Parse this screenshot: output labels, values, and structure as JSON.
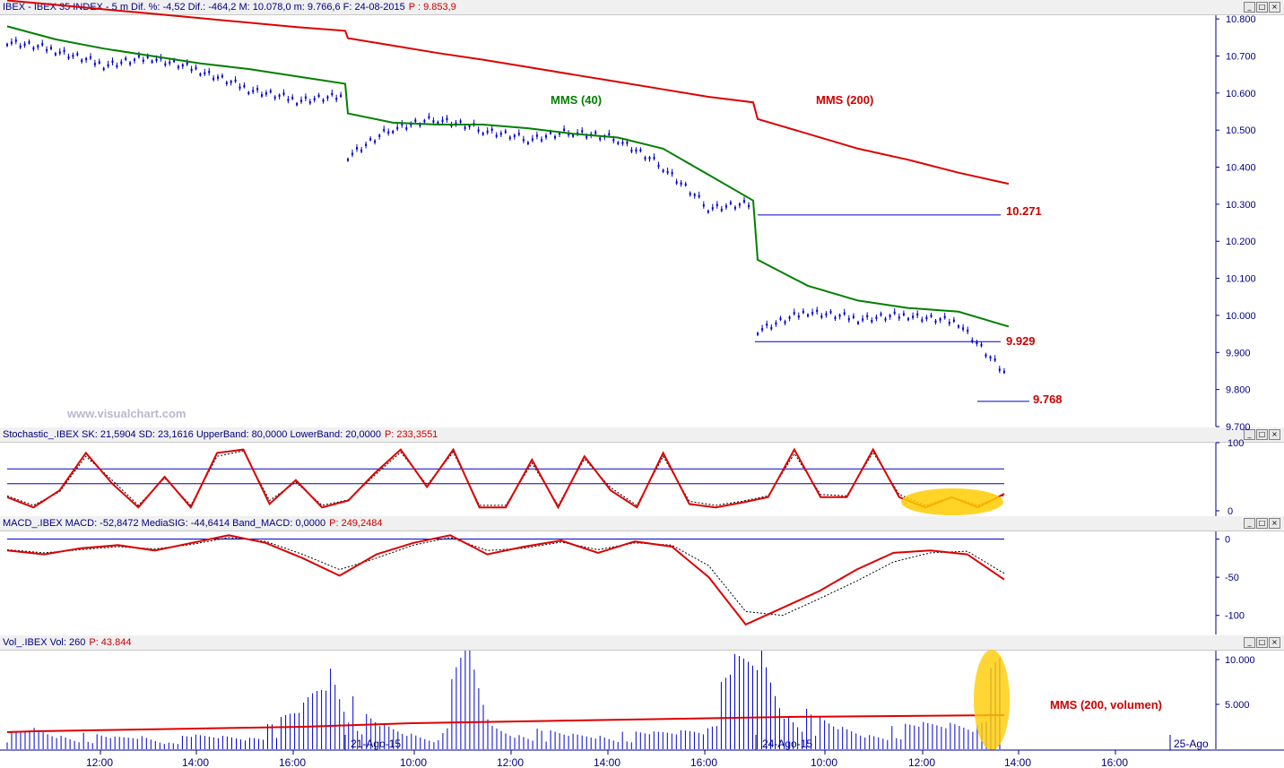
{
  "panels": {
    "price": {
      "title": "IBEX - IBEX 35 INDEX -  5 m  Dif. %: -4,52  Dif.: -464,2  M: 10.078,0  m: 9.766,6  F: 24-08-2015",
      "p_value": "P : 9.853,9"
    },
    "stochastic": {
      "title": "Stochastic_.IBEX SK: 21,5904  SD: 23,1616  UpperBand: 80,0000  LowerBand: 20,0000",
      "p_value": "P: 233,3551"
    },
    "macd": {
      "title": "MACD_.IBEX MACD: -52,8472  MediaSIG: -44,6414  Band_MACD: 0,0000",
      "p_value": "P: 249,2484"
    },
    "volume": {
      "title": "Vol_.IBEX Vol: 260",
      "p_value": "P: 43.844"
    }
  },
  "window_buttons": {
    "minimize": "_",
    "restore": "□",
    "close": "×"
  },
  "watermark": "www.visualchart.com",
  "annotations": {
    "mms40": "MMS (40)",
    "mms200": "MMS (200)",
    "level1": "10.271",
    "level2": "9.929",
    "level3": "9.768",
    "vol_mms": "MMS (200, volumen)"
  },
  "date_labels": [
    "21-Ago-15",
    "24-Ago-15",
    "25-Ago"
  ],
  "x_ticks": [
    "12:00",
    "14:00",
    "16:00",
    "10:00",
    "12:00",
    "14:00",
    "16:00",
    "10:00",
    "12:00",
    "14:00",
    "16:00"
  ],
  "y_axes": {
    "price": [
      "10.800",
      "10.700",
      "10.600",
      "10.500",
      "10.400",
      "10.300",
      "10.200",
      "10.100",
      "10.000",
      "9.900",
      "9.800",
      "9.700"
    ],
    "stochastic": [
      "100",
      "0"
    ],
    "macd": [
      "0",
      "-50",
      "-100"
    ],
    "volume": [
      "10.000",
      "5.000"
    ]
  },
  "colors": {
    "price": "#0000cc",
    "mms40": "#008000",
    "mms200": "#dd0000",
    "indicator": "#dd0000",
    "band": "#0000cc",
    "highlight": "#ffcc00",
    "axis_text": "#000080"
  },
  "chart_data": [
    {
      "type": "line",
      "title": "IBEX - IBEX 35 INDEX -  5 m",
      "x": [
        "21-Ago-15 11:00",
        "21-Ago-15 12:00",
        "21-Ago-15 13:00",
        "21-Ago-15 14:00",
        "21-Ago-15 15:00",
        "21-Ago-15 16:00",
        "21-Ago-15 17:00",
        "21-Ago-15 17:30",
        "24-Ago-15 09:00",
        "24-Ago-15 10:00",
        "24-Ago-15 11:00",
        "24-Ago-15 12:00",
        "24-Ago-15 13:00",
        "24-Ago-15 14:00",
        "24-Ago-15 15:00",
        "24-Ago-15 16:00",
        "24-Ago-15 17:00",
        "24-Ago-15 17:30",
        "25-Ago-15 09:00",
        "25-Ago-15 10:00",
        "25-Ago-15 11:00",
        "25-Ago-15 12:00",
        "25-Ago-15 13:00",
        "25-Ago-15 13:50"
      ],
      "series": [
        {
          "name": "",
          "values": [
            10740,
            10715,
            10675,
            10695,
            10660,
            10610,
            10580,
            10590,
            10430,
            10505,
            10530,
            10500,
            10475,
            10495,
            10475,
            10400,
            10290,
            10300,
            9960,
            10010,
            9990,
            10000,
            9980,
            9830
          ]
        },
        {
          "name": "MMS (40)",
          "values": [
            10780,
            10745,
            10720,
            10700,
            10680,
            10665,
            10645,
            10625,
            10545,
            10520,
            10515,
            10515,
            10505,
            10490,
            10480,
            10450,
            10380,
            10310,
            10150,
            10080,
            10040,
            10020,
            10010,
            9970
          ]
        },
        {
          "name": "MMS (200)",
          "values": [
            10850,
            10838,
            10826,
            10814,
            10802,
            10790,
            10778,
            10768,
            10748,
            10728,
            10708,
            10690,
            10670,
            10650,
            10630,
            10610,
            10590,
            10575,
            10530,
            10490,
            10450,
            10420,
            10385,
            10355
          ]
        }
      ],
      "levels": [
        10271,
        9929,
        9768
      ],
      "ylim": [
        9700,
        10810
      ]
    },
    {
      "type": "line",
      "title": "Stochastic_.IBEX",
      "series": [
        {
          "name": "SK",
          "values": [
            20,
            5,
            30,
            85,
            40,
            5,
            50,
            5,
            85,
            90,
            10,
            45,
            5,
            15,
            55,
            90,
            35,
            90,
            5,
            5,
            75,
            5,
            80,
            30,
            5,
            85,
            10,
            5,
            12,
            20,
            90,
            20,
            20,
            90,
            20,
            5,
            20,
            5,
            25
          ]
        },
        {
          "name": "SD",
          "values": [
            22,
            8,
            28,
            80,
            45,
            8,
            48,
            8,
            80,
            88,
            15,
            42,
            8,
            16,
            52,
            86,
            38,
            86,
            8,
            8,
            70,
            8,
            76,
            34,
            8,
            80,
            14,
            8,
            14,
            22,
            84,
            24,
            22,
            86,
            24,
            8,
            20,
            8,
            23
          ]
        }
      ],
      "bands": [
        80,
        20
      ],
      "ylim": [
        0,
        100
      ]
    },
    {
      "type": "line",
      "title": "MACD_.IBEX",
      "series": [
        {
          "name": "MACD",
          "values": [
            -15,
            -20,
            -12,
            -8,
            -15,
            -5,
            5,
            -5,
            -25,
            -48,
            -20,
            -5,
            5,
            -20,
            -10,
            -2,
            -18,
            -3,
            -10,
            -50,
            -112,
            -90,
            -68,
            -40,
            -18,
            -15,
            -20,
            -53
          ]
        },
        {
          "name": "MediaSIG",
          "values": [
            -14,
            -18,
            -14,
            -10,
            -13,
            -7,
            2,
            -3,
            -20,
            -40,
            -25,
            -8,
            2,
            -15,
            -12,
            -4,
            -14,
            -5,
            -8,
            -35,
            -95,
            -100,
            -78,
            -55,
            -30,
            -18,
            -16,
            -45
          ]
        }
      ],
      "bands": [
        0
      ],
      "ylim": [
        -125,
        10
      ]
    },
    {
      "type": "bar",
      "title": "Vol_.IBEX",
      "series": [
        {
          "name": "Vol",
          "values": [
            1500,
            2200,
            1800,
            1400,
            1200,
            1600,
            1100,
            1300,
            1500,
            1700,
            2500,
            4800,
            10800,
            3500,
            2400,
            1900,
            1500,
            11000,
            2600,
            2100,
            1700,
            1600,
            1800,
            1500,
            1700,
            2300,
            3500,
            8500,
            11000,
            4800,
            3000,
            2300,
            1900,
            2100,
            2600,
            3200,
            4000,
            10500
          ]
        },
        {
          "name": "MMS (200, volumen)",
          "values": [
            1900,
            2000,
            2050,
            2100,
            2150,
            2200,
            2250,
            2300,
            2350,
            2400,
            2450,
            2500,
            2600,
            2700,
            2800,
            2900,
            2950,
            3000,
            3050,
            3100,
            3150,
            3200,
            3250,
            3300,
            3350,
            3400,
            3450,
            3500,
            3550,
            3600,
            3620,
            3650,
            3680,
            3700,
            3720,
            3750,
            3780,
            3800
          ]
        }
      ],
      "ylim": [
        0,
        11000
      ]
    }
  ]
}
